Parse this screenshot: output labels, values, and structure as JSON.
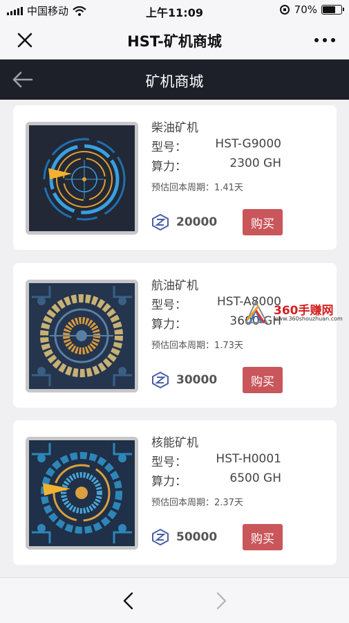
{
  "status_bar": {
    "carrier": "中国移动",
    "time": "上午11:09",
    "battery": "70%",
    "battery_level": 0.7
  },
  "wechat": {
    "title": "HST-矿机商城"
  },
  "header": {
    "title": "矿机商城"
  },
  "labels": {
    "model": "型号：",
    "hashrate": "算力：",
    "buy": "购买"
  },
  "products": [
    {
      "name": "柴油矿机",
      "model": "HST-G9000",
      "hashrate": "2300 GH",
      "period": "预估回本周期：1.41天",
      "price": "20000"
    },
    {
      "name": "航油矿机",
      "model": "HST-A8000",
      "hashrate": "3600 GH",
      "period": "预估回本周期：1.73天",
      "price": "30000"
    },
    {
      "name": "核能矿机",
      "model": "HST-H0001",
      "hashrate": "6500 GH",
      "period": "预估回本周期：2.37天",
      "price": "50000"
    }
  ],
  "watermark": {
    "text": "360手赚网",
    "url": "www.360shouzhuan.com"
  },
  "colors": {
    "buy_button": "#c9565a",
    "header_bg": "#1e2029"
  }
}
